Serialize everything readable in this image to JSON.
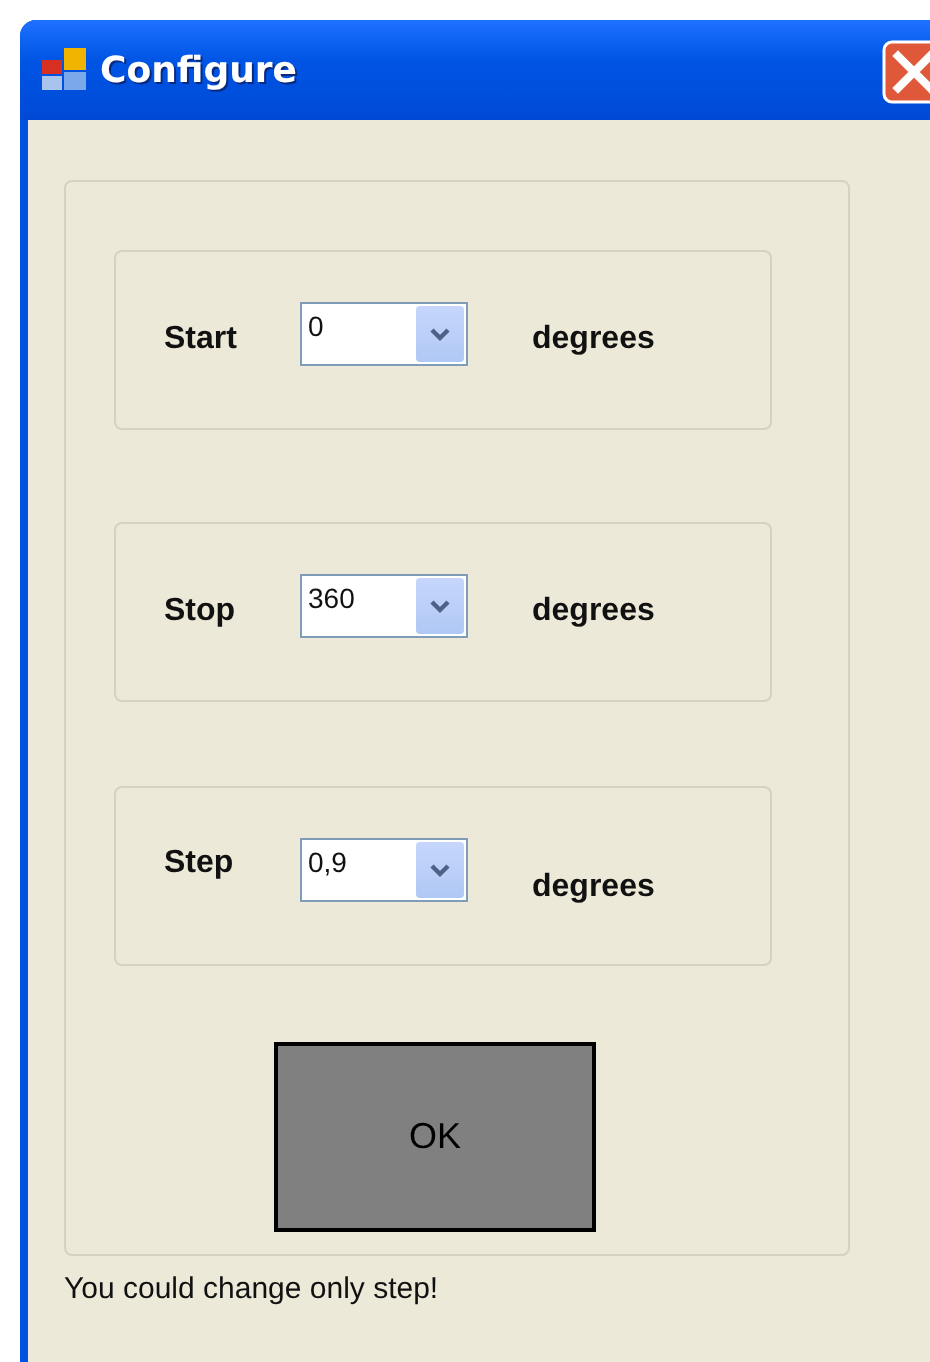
{
  "window": {
    "title": "Configure"
  },
  "rows": [
    {
      "label": "Start",
      "value": "0",
      "unit": "degrees"
    },
    {
      "label": "Stop",
      "value": "360",
      "unit": "degrees"
    },
    {
      "label": "Step",
      "value": "0,9",
      "unit": "degrees"
    }
  ],
  "ok_button": "OK",
  "status_text": "You could change only step!"
}
